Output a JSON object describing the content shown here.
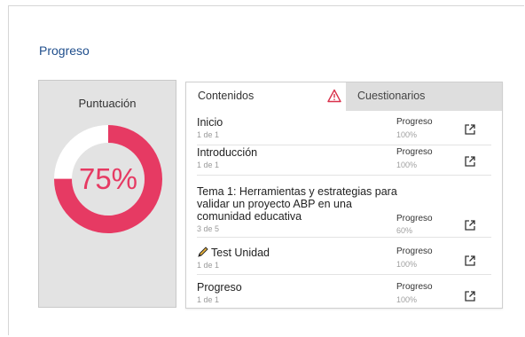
{
  "page": {
    "title": "Progreso"
  },
  "score": {
    "label": "Puntuación",
    "value_text": "75%",
    "value": 0.75,
    "color": "#e63a63"
  },
  "tabs": [
    {
      "label": "Contenidos",
      "warning_icon": "warning-triangle-icon",
      "warning_color": "#d9314b"
    },
    {
      "label": "Cuestionarios"
    }
  ],
  "rows": [
    {
      "title": "Inicio",
      "sub": "1 de 1",
      "progress_label": "Progreso",
      "progress_value": "100%"
    },
    {
      "title": "Introducción",
      "sub": "1 de 1",
      "progress_label": "Progreso",
      "progress_value": "100%"
    },
    {
      "title_lines": [
        "Tema 1: Herramientas y estrategias para",
        "validar un proyecto ABP en una",
        "comunidad educativa"
      ],
      "sub": "3 de 5",
      "progress_label": "Progreso",
      "progress_value": "60%"
    },
    {
      "title": "Test Unidad",
      "icon": "pencil-icon",
      "sub": "1 de 1",
      "progress_label": "Progreso",
      "progress_value": "100%"
    },
    {
      "title": "Progreso",
      "sub": "1 de 1",
      "progress_label": "Progreso",
      "progress_value": "100%"
    }
  ]
}
